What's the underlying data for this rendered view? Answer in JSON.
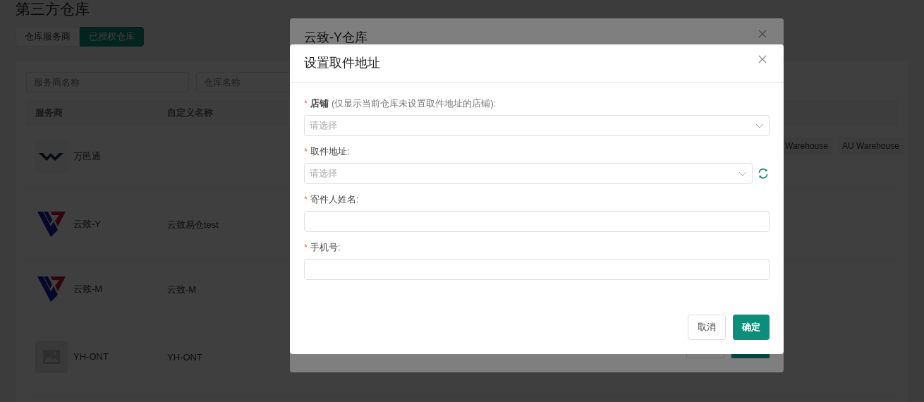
{
  "page": {
    "title": "第三方仓库",
    "tabs": [
      {
        "label": "仓库服务商",
        "selected": false
      },
      {
        "label": "已授权仓库",
        "selected": true
      }
    ],
    "filters": [
      {
        "placeholder": "服务商名称"
      },
      {
        "placeholder": "仓库名称"
      }
    ],
    "table": {
      "columns": [
        "服务商",
        "自定义名称"
      ],
      "rows": [
        {
          "kind": "w",
          "provider": "万邑通",
          "custom_name": "",
          "tags": [
            "Warehouse",
            "AU Warehouse"
          ]
        },
        {
          "kind": "yz",
          "provider": "云致-Y",
          "custom_name": "云致易仓test",
          "tags": []
        },
        {
          "kind": "yz",
          "provider": "云致-M",
          "custom_name": "云致-M",
          "tags": []
        },
        {
          "kind": "image",
          "provider": "YH-ONT",
          "custom_name": "YH-ONT",
          "tags": []
        }
      ]
    }
  },
  "back_dialog": {
    "title": "云致-Y仓库"
  },
  "dialog": {
    "title": "设置取件地址",
    "fields": [
      {
        "kind": "select",
        "mark": "*",
        "label": "店铺",
        "note": "(仅显示当前仓库未设置取件地址的店铺):",
        "placeholder": "请选择",
        "refresh": false
      },
      {
        "kind": "select",
        "mark": "*",
        "label": "取件地址:",
        "placeholder": "请选择",
        "refresh": true
      },
      {
        "kind": "text",
        "mark": "*",
        "label": "寄件人姓名:",
        "refresh": false
      },
      {
        "kind": "text",
        "mark": "*",
        "label": "手机号:",
        "refresh": false
      }
    ],
    "buttons": [
      {
        "label": "取消",
        "kind": "default"
      },
      {
        "label": "确定",
        "kind": "primary"
      }
    ]
  }
}
